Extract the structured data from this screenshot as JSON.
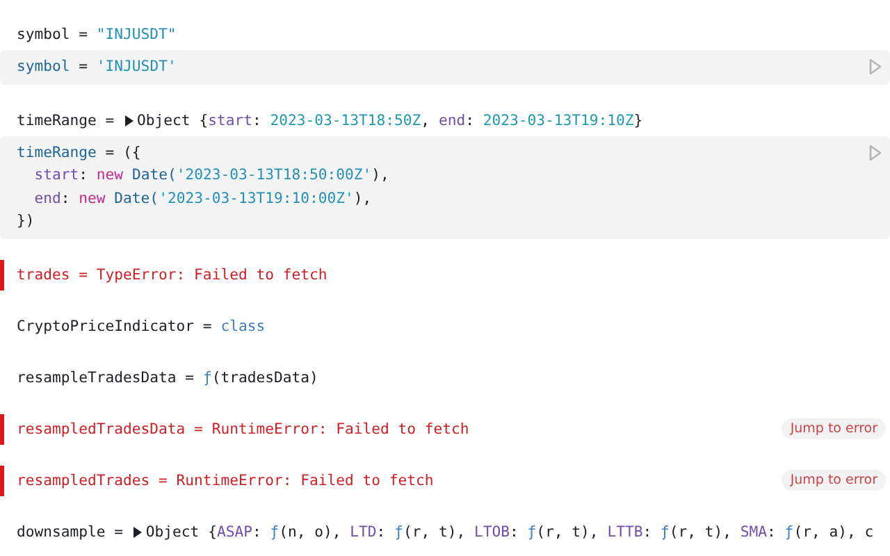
{
  "cells": [
    {
      "error": false,
      "output": [
        {
          "text": "symbol = ",
          "kind": "plain"
        },
        {
          "text": "\"INJUSDT\"",
          "kind": "string"
        }
      ],
      "code": [
        [
          {
            "text": "symbol",
            "kind": "var"
          },
          {
            "text": " = ",
            "kind": "plain"
          },
          {
            "text": "'INJUSDT'",
            "kind": "string"
          }
        ]
      ]
    },
    {
      "error": false,
      "output": [
        {
          "text": "timeRange = ",
          "kind": "plain"
        },
        {
          "kind": "toggle",
          "expanded": false
        },
        {
          "text": "Object {",
          "kind": "plain"
        },
        {
          "text": "start",
          "kind": "prop"
        },
        {
          "text": ": ",
          "kind": "plain"
        },
        {
          "text": "2023-03-13T18:50Z",
          "kind": "date"
        },
        {
          "text": ", ",
          "kind": "plain"
        },
        {
          "text": "end",
          "kind": "prop"
        },
        {
          "text": ": ",
          "kind": "plain"
        },
        {
          "text": "2023-03-13T19:10Z",
          "kind": "date"
        },
        {
          "text": "}",
          "kind": "plain"
        }
      ],
      "code": [
        [
          {
            "text": "timeRange",
            "kind": "var"
          },
          {
            "text": " = ({",
            "kind": "plain"
          }
        ],
        [
          {
            "text": "  start",
            "kind": "prop"
          },
          {
            "text": ": ",
            "kind": "plain"
          },
          {
            "text": "new",
            "kind": "keyword"
          },
          {
            "text": " Date(",
            "kind": "var"
          },
          {
            "text": "'2023-03-13T18:50:00Z'",
            "kind": "string"
          },
          {
            "text": "),",
            "kind": "plain"
          }
        ],
        [
          {
            "text": "  end",
            "kind": "prop"
          },
          {
            "text": ": ",
            "kind": "plain"
          },
          {
            "text": "new",
            "kind": "keyword"
          },
          {
            "text": " Date(",
            "kind": "var"
          },
          {
            "text": "'2023-03-13T19:10:00Z'",
            "kind": "string"
          },
          {
            "text": "),",
            "kind": "plain"
          }
        ],
        [
          {
            "text": "})",
            "kind": "plain"
          }
        ]
      ]
    },
    {
      "error": true,
      "output": [
        {
          "text": "trades = TypeError: Failed to fetch",
          "kind": "plain"
        }
      ]
    },
    {
      "error": false,
      "output": [
        {
          "text": "CryptoPriceIndicator = ",
          "kind": "plain"
        },
        {
          "text": "class",
          "kind": "func"
        }
      ]
    },
    {
      "error": false,
      "output": [
        {
          "text": "resampleTradesData = ",
          "kind": "plain"
        },
        {
          "text": "ƒ",
          "kind": "func"
        },
        {
          "text": "(tradesData)",
          "kind": "plain"
        }
      ]
    },
    {
      "error": true,
      "output": [
        {
          "text": "resampledTradesData = RuntimeError: Failed to fetch",
          "kind": "plain"
        }
      ],
      "jump_button": "Jump to error"
    },
    {
      "error": true,
      "output": [
        {
          "text": "resampledTrades = RuntimeError: Failed to fetch",
          "kind": "plain"
        }
      ],
      "jump_button": "Jump to error"
    },
    {
      "error": false,
      "output": [
        {
          "text": "downsample = ",
          "kind": "plain"
        },
        {
          "kind": "toggle",
          "expanded": false
        },
        {
          "text": "Object {",
          "kind": "plain"
        },
        {
          "text": "ASAP",
          "kind": "prop"
        },
        {
          "text": ": ",
          "kind": "plain"
        },
        {
          "text": "ƒ",
          "kind": "func"
        },
        {
          "text": "(n, o), ",
          "kind": "plain"
        },
        {
          "text": "LTD",
          "kind": "prop"
        },
        {
          "text": ": ",
          "kind": "plain"
        },
        {
          "text": "ƒ",
          "kind": "func"
        },
        {
          "text": "(r, t), ",
          "kind": "plain"
        },
        {
          "text": "LTOB",
          "kind": "prop"
        },
        {
          "text": ": ",
          "kind": "plain"
        },
        {
          "text": "ƒ",
          "kind": "func"
        },
        {
          "text": "(r, t), ",
          "kind": "plain"
        },
        {
          "text": "LTTB",
          "kind": "prop"
        },
        {
          "text": ": ",
          "kind": "plain"
        },
        {
          "text": "ƒ",
          "kind": "func"
        },
        {
          "text": "(r, t), ",
          "kind": "plain"
        },
        {
          "text": "SMA",
          "kind": "prop"
        },
        {
          "text": ": ",
          "kind": "plain"
        },
        {
          "text": "ƒ",
          "kind": "func"
        },
        {
          "text": "(r, a), c",
          "kind": "plain"
        }
      ]
    }
  ]
}
